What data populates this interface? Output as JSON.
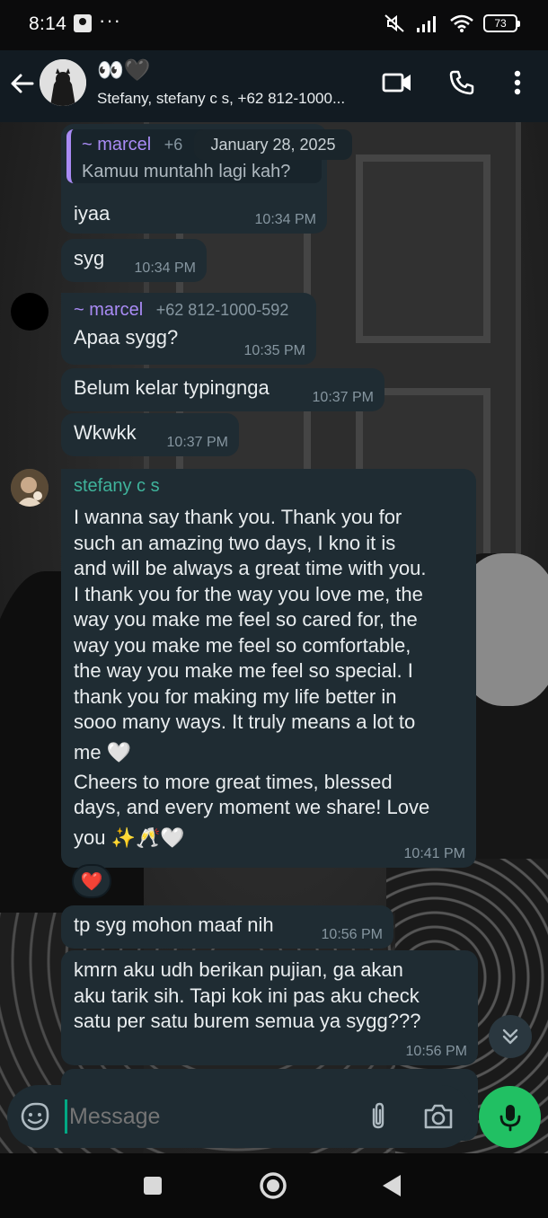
{
  "status_bar": {
    "time": "8:14",
    "more": "···",
    "battery": "73"
  },
  "header": {
    "title": "👀🖤",
    "subtitle": "Stefany, stefany c s, +62 812-1000..."
  },
  "date_pill": "January 28, 2025",
  "messages": [
    {
      "quote_sender": "~ marcel",
      "quote_phone": "+6",
      "quote_text": "Kamuu muntahh lagi kah?",
      "text": "iyaa",
      "time": "10:34 PM"
    },
    {
      "text": "syg",
      "time": "10:34 PM"
    },
    {
      "sender": "~ marcel",
      "phone": "+62 812-1000-592",
      "text": "Apaa sygg?",
      "time": "10:35 PM"
    },
    {
      "text": "Belum kelar typingnga",
      "time": "10:37 PM"
    },
    {
      "text": "Wkwkk",
      "time": "10:37 PM"
    },
    {
      "sender": "stefany c s",
      "text_lines": [
        "I wanna say thank you. Thank you for",
        "such an amazing two days, I kno it is",
        "and will be always a great time with you.",
        "I thank you for the way you love me, the",
        "way you make me feel so cared for, the",
        "way you make me feel so comfortable,",
        "the way you make me feel so special. I",
        "thank you for making my life better in",
        "sooo many ways. It truly means a lot to",
        "me 🤍",
        "Cheers to more great times, blessed",
        "days, and every moment we share! Love",
        "you ✨🥂🤍"
      ],
      "time": "10:41 PM",
      "reaction": "❤️"
    },
    {
      "text": "tp syg mohon maaf nih",
      "time": "10:56 PM"
    },
    {
      "text_lines": [
        "kmrn aku udh berikan pujian, ga akan",
        "aku tarik sih. Tapi kok ini pas aku check",
        "satu per satu burem semua ya sygg???"
      ],
      "time": "10:56 PM"
    }
  ],
  "input": {
    "placeholder": "Message"
  },
  "colors": {
    "accent": "#21c063",
    "bubble": "#1f2c33",
    "marcel": "#a98bf5",
    "stefany": "#3fb39b"
  }
}
